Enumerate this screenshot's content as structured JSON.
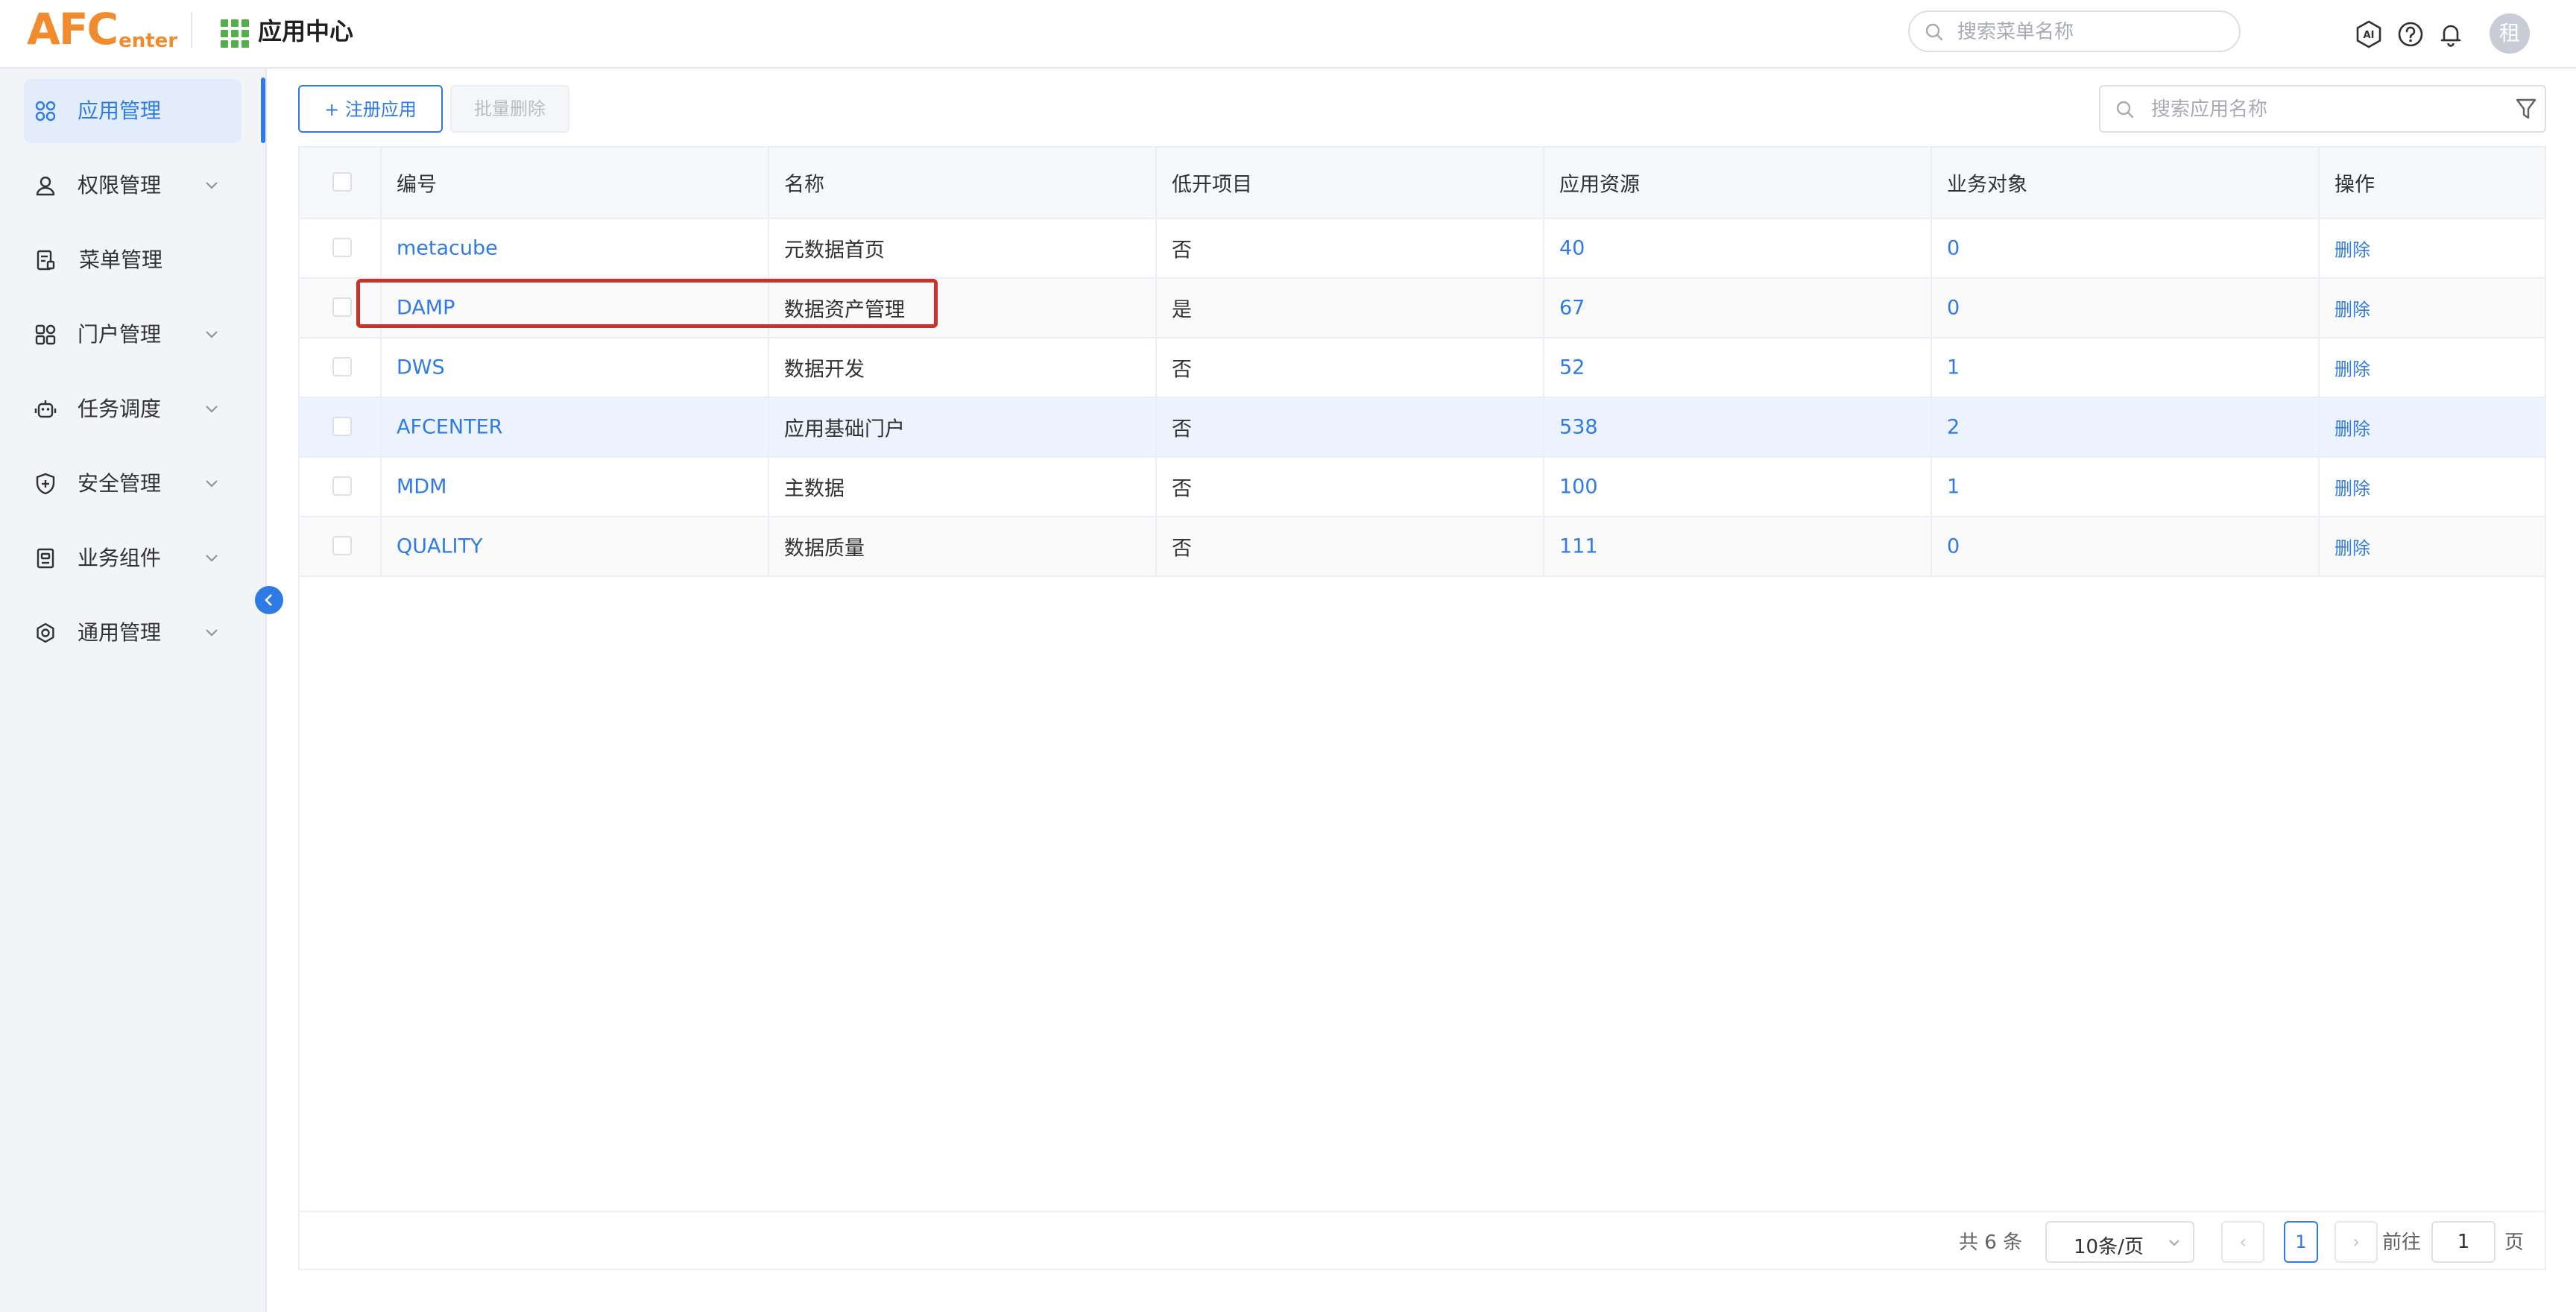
{
  "header": {
    "logo_main": "AFC",
    "logo_sub": "enter",
    "app_title": "应用中心",
    "search_placeholder": "搜索菜单名称",
    "avatar_text": "租"
  },
  "sidebar": {
    "items": [
      {
        "label": "应用管理",
        "icon": "apps-icon",
        "active": true,
        "has_children": false
      },
      {
        "label": "权限管理",
        "icon": "user-icon",
        "active": false,
        "has_children": true
      },
      {
        "label": "菜单管理",
        "icon": "menu-doc-icon",
        "active": false,
        "has_children": false
      },
      {
        "label": "门户管理",
        "icon": "portal-icon",
        "active": false,
        "has_children": true
      },
      {
        "label": "任务调度",
        "icon": "robot-icon",
        "active": false,
        "has_children": true
      },
      {
        "label": "安全管理",
        "icon": "shield-icon",
        "active": false,
        "has_children": true
      },
      {
        "label": "业务组件",
        "icon": "component-icon",
        "active": false,
        "has_children": true
      },
      {
        "label": "通用管理",
        "icon": "settings-icon",
        "active": false,
        "has_children": true
      }
    ]
  },
  "toolbar": {
    "register_label": "+ 注册应用",
    "batch_delete_label": "批量删除",
    "search_placeholder": "搜索应用名称"
  },
  "table": {
    "columns": [
      "编号",
      "名称",
      "低开项目",
      "应用资源",
      "业务对象",
      "操作"
    ],
    "rows": [
      {
        "code": "metacube",
        "name": "元数据首页",
        "lowcode": "否",
        "resources": "40",
        "objects": "0",
        "action": "删除"
      },
      {
        "code": "DAMP",
        "name": "数据资产管理",
        "lowcode": "是",
        "resources": "67",
        "objects": "0",
        "action": "删除"
      },
      {
        "code": "DWS",
        "name": "数据开发",
        "lowcode": "否",
        "resources": "52",
        "objects": "1",
        "action": "删除"
      },
      {
        "code": "AFCENTER",
        "name": "应用基础门户",
        "lowcode": "否",
        "resources": "538",
        "objects": "2",
        "action": "删除"
      },
      {
        "code": "MDM",
        "name": "主数据",
        "lowcode": "否",
        "resources": "100",
        "objects": "1",
        "action": "删除"
      },
      {
        "code": "QUALITY",
        "name": "数据质量",
        "lowcode": "否",
        "resources": "111",
        "objects": "0",
        "action": "删除"
      }
    ]
  },
  "pagination": {
    "total": "共 6 条",
    "page_size": "10条/页",
    "prev": "‹",
    "next": "›",
    "current_page": "1",
    "goto_label": "前往",
    "goto_value": "1",
    "page_unit": "页"
  },
  "colors": {
    "accent": "#2f7be5",
    "logo": "#f08c2e",
    "annotation": "#c8322a"
  }
}
